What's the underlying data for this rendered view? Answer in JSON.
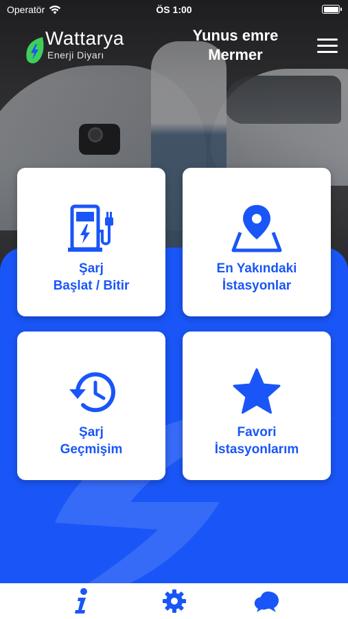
{
  "status_bar": {
    "carrier": "Operatör",
    "time": "ÖS 1:00"
  },
  "header": {
    "logo_word": "Wattarya",
    "logo_subtitle": "Enerji Diyarı",
    "user_name": "Yunus emre Mermer"
  },
  "tiles": [
    {
      "label": "Şarj\nBaşlat / Bitir",
      "icon": "ev-charger-icon"
    },
    {
      "label": "En Yakındaki\nİstasyonlar",
      "icon": "map-pin-icon"
    },
    {
      "label": "Şarj\nGeçmişim",
      "icon": "history-icon"
    },
    {
      "label": "Favori\nİstasyonlarım",
      "icon": "star-icon"
    }
  ],
  "bottom_bar": {
    "items": [
      {
        "icon": "info-icon"
      },
      {
        "icon": "gear-icon"
      },
      {
        "icon": "chat-icon"
      }
    ]
  },
  "colors": {
    "primary": "#1a56f7",
    "logo_green": "#3ecf5a",
    "white": "#ffffff"
  }
}
